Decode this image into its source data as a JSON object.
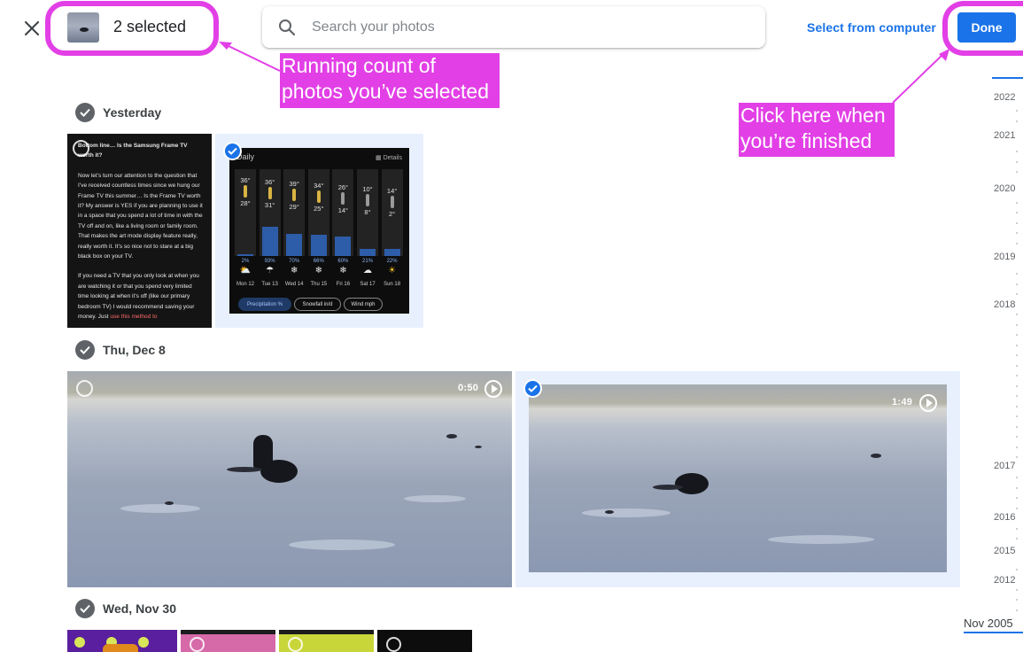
{
  "header": {
    "close_icon": "close-icon",
    "selected_count": "2 selected",
    "search_placeholder": "Search your photos",
    "select_from_computer": "Select from computer",
    "done_label": "Done"
  },
  "annotations": {
    "count_callout_line1": "Running count of",
    "count_callout_line2": "photos you’ve selected",
    "done_callout_line1": "Click here when",
    "done_callout_line2": "you’re finished",
    "color": "#e23fe6"
  },
  "sections": [
    {
      "date": "Yesterday",
      "photos": [
        {
          "kind": "screenshot-text",
          "selected": false,
          "paragraphs": [
            "Bottom line… Is the Samsung Frame TV worth it?",
            "Now let’s turn our attention to the question that I’ve received countless times since we hung our Frame TV this summer… Is the Frame TV worth it? My answer is YES if you are planning to use it in a space that you spend a lot of time in with the TV off and on, like a living room or family room. That makes the art mode display feature really, really worth it. It’s so nice not to stare at a big black box on your TV.",
            "If you need a TV that you only look at when you are watching it or that you spend very limited time looking at when it’s off (like our primary bedroom TV) I would recommend saving your money. Just",
            "use this method to"
          ]
        },
        {
          "kind": "weather-screenshot",
          "selected": true,
          "title": "Daily",
          "details": "Details",
          "days": [
            {
              "day": "Mon 12",
              "high": "36°",
              "low": "28°",
              "pct": "2%",
              "icon": "⛅",
              "precip_frac": 0.02
            },
            {
              "day": "Tue 13",
              "high": "36°",
              "low": "31°",
              "pct": "93%",
              "icon": "☂",
              "precip_frac": 0.93
            },
            {
              "day": "Wed 14",
              "high": "39°",
              "low": "29°",
              "pct": "70%",
              "icon": "❄",
              "precip_frac": 0.7
            },
            {
              "day": "Thu 15",
              "high": "34°",
              "low": "25°",
              "pct": "66%",
              "icon": "❄",
              "precip_frac": 0.66
            },
            {
              "day": "Fri 16",
              "high": "26°",
              "low": "14°",
              "pct": "60%",
              "icon": "❄",
              "precip_frac": 0.6
            },
            {
              "day": "Sat 17",
              "high": "10°",
              "low": "8°",
              "pct": "21%",
              "icon": "☁",
              "precip_frac": 0.21
            },
            {
              "day": "Sun 18",
              "high": "14°",
              "low": "2°",
              "pct": "22%",
              "icon": "☀",
              "precip_frac": 0.22
            }
          ],
          "chips": [
            "Precipitation %",
            "Snowfall in/d",
            "Wind mph"
          ]
        }
      ]
    },
    {
      "date": "Thu, Dec 8",
      "photos": [
        {
          "kind": "video",
          "selected": false,
          "duration": "0:50"
        },
        {
          "kind": "video",
          "selected": true,
          "duration": "1:49"
        }
      ]
    },
    {
      "date": "Wed, Nov 30",
      "photos": [
        {
          "kind": "image",
          "selected": false
        },
        {
          "kind": "image",
          "selected": false
        },
        {
          "kind": "image",
          "selected": false
        },
        {
          "kind": "image",
          "selected": false
        }
      ]
    }
  ],
  "timeline": {
    "years": [
      "2022",
      "2021",
      "2020",
      "2019",
      "2018",
      "2017",
      "2016",
      "2015",
      "2012"
    ],
    "current": "Nov 2005"
  },
  "colors": {
    "accent": "#1a73e8",
    "annotation": "#e23fe6",
    "selected_bg": "#e8f0fe"
  }
}
